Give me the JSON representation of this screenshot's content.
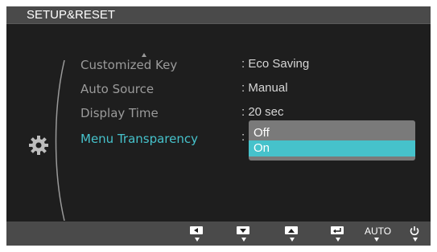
{
  "header": {
    "title": "SETUP&RESET"
  },
  "menu": {
    "items": [
      {
        "label": "Customized Key",
        "value": ": Eco Saving"
      },
      {
        "label": "Auto Source",
        "value": ": Manual"
      },
      {
        "label": "Display Time",
        "value": ": 20 sec"
      },
      {
        "label": "Menu Transparency",
        "value": ":"
      }
    ]
  },
  "dropdown": {
    "options": [
      "Off",
      "On"
    ],
    "selected": "On"
  },
  "bottom_bar": {
    "buttons": [
      {
        "icon": "left-arrow-icon"
      },
      {
        "icon": "down-arrow-icon"
      },
      {
        "icon": "up-arrow-icon"
      },
      {
        "icon": "enter-icon"
      },
      {
        "label": "AUTO"
      },
      {
        "icon": "power-icon"
      }
    ]
  },
  "colors": {
    "accent": "#46c2cb",
    "background": "#1e1e1e",
    "bar": "#4a4a4a",
    "dropdown": "#7a7a7a",
    "text_dim": "#9b9b9b"
  }
}
